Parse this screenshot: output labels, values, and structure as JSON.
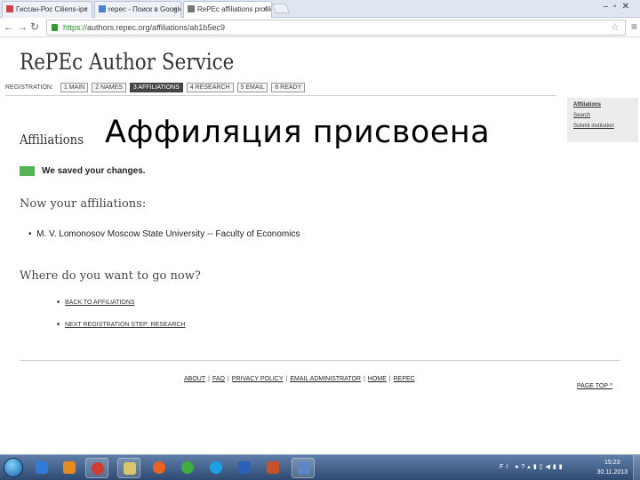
{
  "browser": {
    "tabs": [
      {
        "title": "Гиссан-Рос Ciliens-ipc",
        "active": false
      },
      {
        "title": "repec - Поиск в Google",
        "active": false
      },
      {
        "title": "RePEc affiliations profile",
        "active": true
      }
    ],
    "url_scheme": "https://",
    "url_rest": "authors.repec.org/affiliations/ab1b5ec9"
  },
  "page": {
    "brand": "RePEc Author Service",
    "registration": {
      "label": "Registration:",
      "steps": [
        "1 Main",
        "2 Names",
        "3 Affiliations",
        "4 Research",
        "5 Email",
        "6 Ready"
      ],
      "current_index": 2
    },
    "sidebar": {
      "items": [
        "Affiliations",
        "Search",
        "Submit institution"
      ]
    },
    "heading": "Affiliations",
    "overlay_caption": "Аффиляция присвоена",
    "saved_message": "We saved your changes.",
    "affiliations_heading": "Now your affiliations:",
    "affiliations": [
      "M. V. Lomonosov Moscow State University -- Faculty of Economics"
    ],
    "where_heading": "Where do you want to go now?",
    "nav_links": [
      "Back to affiliations",
      "Next registration step: research"
    ],
    "footer": {
      "links": [
        "About",
        "FAQ",
        "Privacy policy",
        "Email administrator",
        "Home",
        "RePEc"
      ]
    },
    "page_top": "Page top ^"
  },
  "taskbar": {
    "language": "FI",
    "clock_time": "15:23",
    "clock_date": "30.11.2013",
    "colors": {
      "ie": "#2f7bd6",
      "media": "#e58a1e",
      "chrome": "#d23b2f",
      "notepad": "#d9c86a",
      "firefox": "#e8641f",
      "icq": "#3fae3f",
      "skype": "#1da1e6",
      "word": "#2b5fb8",
      "powerpoint": "#c8502a",
      "picture": "#5a86c4"
    }
  }
}
